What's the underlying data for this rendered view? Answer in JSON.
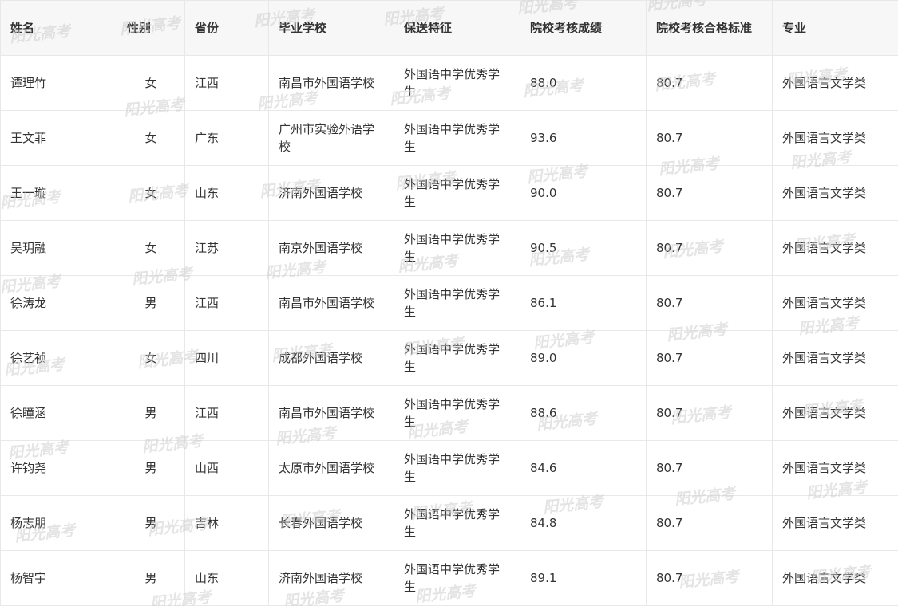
{
  "table": {
    "headers": [
      "姓名",
      "性别",
      "省份",
      "毕业学校",
      "保送特征",
      "院校考核成绩",
      "院校考核合格标准",
      "专业"
    ],
    "rows": [
      [
        "谭理竹",
        "女",
        "江西",
        "南昌市外国语学校",
        "外国语中学优秀学生",
        "88.0",
        "80.7",
        "外国语言文学类"
      ],
      [
        "王文菲",
        "女",
        "广东",
        "广州市实验外语学校",
        "外国语中学优秀学生",
        "93.6",
        "80.7",
        "外国语言文学类"
      ],
      [
        "王一璇",
        "女",
        "山东",
        "济南外国语学校",
        "外国语中学优秀学生",
        "90.0",
        "80.7",
        "外国语言文学类"
      ],
      [
        "吴玥融",
        "女",
        "江苏",
        "南京外国语学校",
        "外国语中学优秀学生",
        "90.5",
        "80.7",
        "外国语言文学类"
      ],
      [
        "徐涛龙",
        "男",
        "江西",
        "南昌市外国语学校",
        "外国语中学优秀学生",
        "86.1",
        "80.7",
        "外国语言文学类"
      ],
      [
        "徐艺祯",
        "女",
        "四川",
        "成都外国语学校",
        "外国语中学优秀学生",
        "89.0",
        "80.7",
        "外国语言文学类"
      ],
      [
        "徐瞳涵",
        "男",
        "江西",
        "南昌市外国语学校",
        "外国语中学优秀学生",
        "88.6",
        "80.7",
        "外国语言文学类"
      ],
      [
        "许钧尧",
        "男",
        "山西",
        "太原市外国语学校",
        "外国语中学优秀学生",
        "84.6",
        "80.7",
        "外国语言文学类"
      ],
      [
        "杨志朋",
        "男",
        "吉林",
        "长春外国语学校",
        "外国语中学优秀学生",
        "84.8",
        "80.7",
        "外国语言文学类"
      ],
      [
        "杨智宇",
        "男",
        "山东",
        "济南外国语学校",
        "外国语中学优秀学生",
        "89.1",
        "80.7",
        "外国语言文学类"
      ]
    ]
  },
  "watermark": {
    "text": "阳光高考",
    "color": "#cdcdcd"
  }
}
